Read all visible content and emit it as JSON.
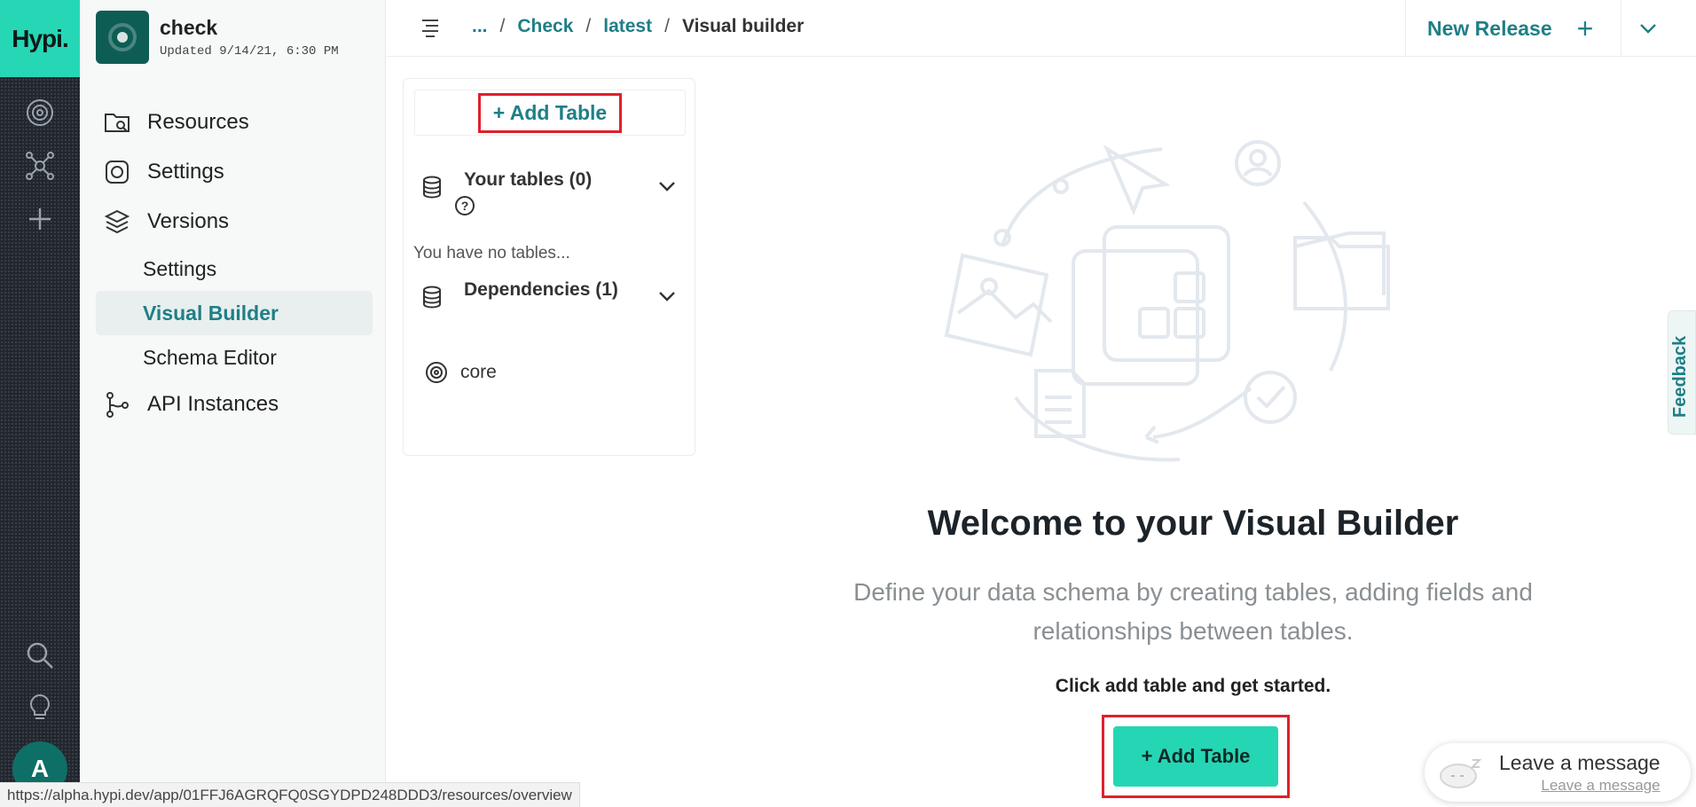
{
  "rail": {
    "logo": "Hypi.",
    "avatar": "A",
    "icons": [
      "target-icon",
      "network-icon",
      "plus-icon",
      "search-icon",
      "bulb-icon"
    ]
  },
  "project": {
    "name": "check",
    "updated": "Updated 9/14/21, 6:30 PM"
  },
  "sidebar": {
    "items": [
      {
        "label": "Resources",
        "icon": "folder-search-icon"
      },
      {
        "label": "Settings",
        "icon": "instagram-like-icon"
      },
      {
        "label": "Versions",
        "icon": "layers-icon"
      },
      {
        "label": "Settings",
        "sub": true
      },
      {
        "label": "Visual Builder",
        "sub": true,
        "active": true
      },
      {
        "label": "Schema Editor",
        "sub": true
      },
      {
        "label": "API Instances",
        "icon": "git-branch-icon"
      }
    ]
  },
  "topbar": {
    "breadcrumb": {
      "ellipsis": "...",
      "sep": "/",
      "check": "Check",
      "latest": "latest",
      "current": "Visual builder"
    },
    "new_release": "New Release",
    "plus": "+"
  },
  "panel": {
    "add_table": "+ Add Table",
    "your_tables": "Your tables (0)",
    "help": "?",
    "empty": "You have no tables...",
    "dependencies": "Dependencies (1)",
    "dependency_item": "core"
  },
  "hero": {
    "title": "Welcome to your Visual Builder",
    "description": "Define your data schema by creating tables, adding fields and relationships between tables.",
    "cta_note": "Click add table and get started.",
    "cta_button": "+ Add Table"
  },
  "feedback": "Feedback",
  "chat": {
    "title": "Leave a message",
    "subtitle": "Leave a message"
  },
  "status_url": "https://alpha.hypi.dev/app/01FFJ6AGRQFQ0SGYDPD248DDD3/resources/overview",
  "colors": {
    "accent": "#1f7f86",
    "brand": "#25d6b5",
    "rail": "#22272e",
    "highlight_border": "#e0202b"
  }
}
